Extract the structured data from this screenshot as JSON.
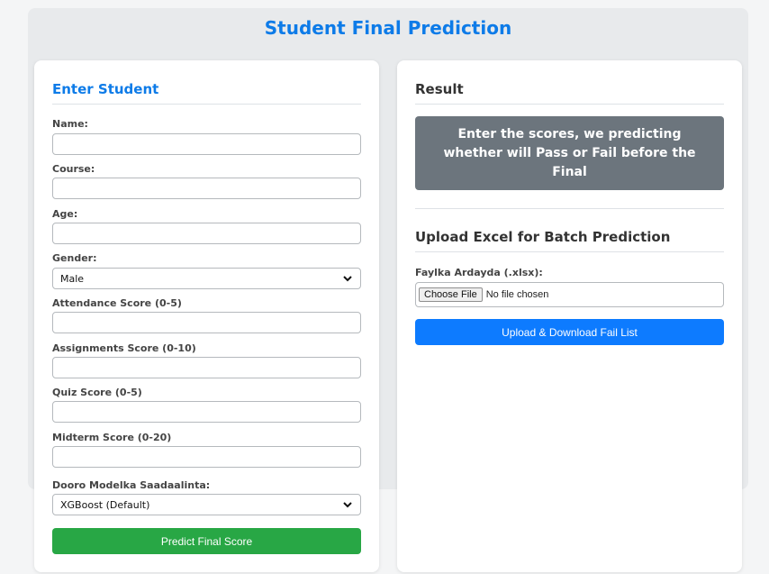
{
  "app": {
    "title": "Student Final Prediction"
  },
  "form": {
    "heading": "Enter Student",
    "fields": [
      {
        "label": "Name:",
        "value": ""
      },
      {
        "label": "Course:",
        "value": ""
      },
      {
        "label": "Age:",
        "value": ""
      }
    ],
    "gender": {
      "label": "Gender:",
      "value": "Male"
    },
    "scores": [
      {
        "label": "Attendance Score (0-5)",
        "value": ""
      },
      {
        "label": "Assignments Score (0-10)",
        "value": ""
      },
      {
        "label": "Quiz Score (0-5)",
        "value": ""
      },
      {
        "label": "Midterm Score (0-20)",
        "value": ""
      }
    ],
    "model": {
      "label": "Dooro Modelka Saadaalinta:",
      "value": "XGBoost (Default)"
    },
    "submit_label": "Predict Final Score"
  },
  "result": {
    "heading": "Result",
    "message": "Enter the scores, we predicting whether will Pass or Fail before the Final"
  },
  "upload": {
    "heading": "Upload Excel for Batch Prediction",
    "file_label": "Faylka Ardayda (.xlsx):",
    "choose_label": "Choose File",
    "file_status": "No file chosen",
    "button_label": "Upload & Download Fail List"
  },
  "colors": {
    "accent": "#0d7be8",
    "success": "#28a745",
    "primary": "#0d7bff",
    "result_bg": "#6c757d"
  }
}
